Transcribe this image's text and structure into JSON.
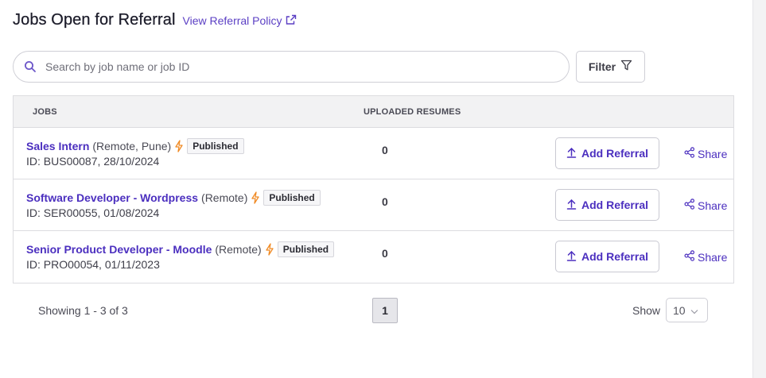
{
  "header": {
    "title": "Jobs Open for Referral",
    "policy_link": "View Referral Policy"
  },
  "search": {
    "placeholder": "Search by job name or job ID",
    "value": ""
  },
  "filter": {
    "label": "Filter"
  },
  "table": {
    "columns": {
      "jobs": "JOBS",
      "uploaded_resumes": "UPLOADED RESUMES"
    },
    "rows": [
      {
        "title": "Sales Intern",
        "location": "(Remote, Pune)",
        "status": "Published",
        "id_line": "ID: BUS00087, 28/10/2024",
        "resumes": "0",
        "add_label": "Add Referral",
        "share_label": "Share"
      },
      {
        "title": "Software Developer - Wordpress",
        "location": "(Remote)",
        "status": "Published",
        "id_line": "ID: SER00055, 01/08/2024",
        "resumes": "0",
        "add_label": "Add Referral",
        "share_label": "Share"
      },
      {
        "title": "Senior Product Developer - Moodle",
        "location": "(Remote)",
        "status": "Published",
        "id_line": "ID: PRO00054, 01/11/2023",
        "resumes": "0",
        "add_label": "Add Referral",
        "share_label": "Share"
      }
    ]
  },
  "pagination": {
    "showing": "Showing 1 - 3 of 3",
    "current_page": "1",
    "show_label": "Show",
    "page_size": "10"
  },
  "icons": {
    "external_link": "external-link-icon",
    "search": "search-icon",
    "filter": "funnel-icon",
    "bolt": "lightning-bolt-icon",
    "upload": "upload-arrow-icon",
    "share": "share-nodes-icon",
    "chevron": "chevron-down-icon"
  },
  "colors": {
    "accent": "#4b2fbf",
    "bolt": "#f08a24",
    "border": "#dcdce0"
  }
}
